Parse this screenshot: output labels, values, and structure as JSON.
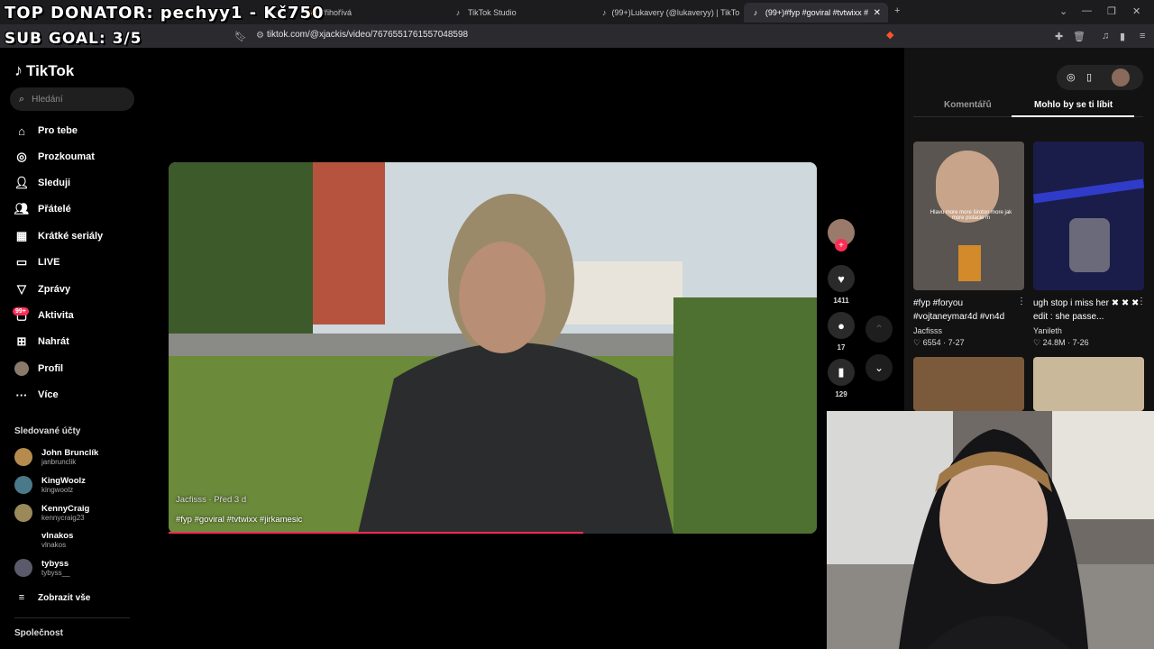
{
  "browser": {
    "tabs": [
      {
        "label": "Přihořívá",
        "icon": "fire-icon"
      },
      {
        "label": "TikTok Studio",
        "icon": "tiktok-icon"
      },
      {
        "label": "(99+)Lukavery (@lukaveryy) | TikTok",
        "icon": "tiktok-icon"
      },
      {
        "label": "(99+)#fyp #goviral #tvtwixx #",
        "icon": "tiktok-icon",
        "active": true
      }
    ],
    "url": "tiktok.com/@xjackis/video/7676551761557048598"
  },
  "overlay": {
    "donator": "TOP DONATOR: pechyy1 - Kč750",
    "goal": "SUB GOAL: 3/5"
  },
  "sidebar": {
    "logo": "TikTok",
    "search_placeholder": "Hledání",
    "nav": [
      {
        "label": "Pro tebe",
        "icon": "home-icon"
      },
      {
        "label": "Prozkoumat",
        "icon": "compass-icon"
      },
      {
        "label": "Sleduji",
        "icon": "following-icon"
      },
      {
        "label": "Přátelé",
        "icon": "friends-icon"
      },
      {
        "label": "Krátké seriály",
        "icon": "series-icon"
      },
      {
        "label": "LIVE",
        "icon": "live-icon"
      },
      {
        "label": "Zprávy",
        "icon": "messages-icon"
      },
      {
        "label": "Aktivita",
        "icon": "activity-icon"
      },
      {
        "label": "Nahrát",
        "icon": "upload-icon"
      },
      {
        "label": "Profil",
        "icon": "profile-avatar"
      },
      {
        "label": "Více",
        "icon": "more-icon"
      }
    ],
    "activity_badge": "99+",
    "followed_title": "Sledované účty",
    "accounts": [
      {
        "name": "John Brunclík",
        "handle": "janbrunclik"
      },
      {
        "name": "KingWoolz",
        "handle": "kingwoolz"
      },
      {
        "name": "KennyCraig",
        "handle": "kennycraig23"
      },
      {
        "name": "vlnakos",
        "handle": "vlnakos"
      },
      {
        "name": "tybyss",
        "handle": "tybyss__"
      }
    ],
    "show_all": "Zobrazit vše",
    "company": "Společnost"
  },
  "video": {
    "author": "Jacfisss · Před 3 d",
    "tags": "#fyp #goviral #tvtwixx #jirkamesic",
    "progress": 0.64
  },
  "actions": {
    "likes": "1411",
    "comments": "17",
    "saves": "129"
  },
  "right_panel": {
    "tabs": [
      "Komentářů",
      "Mohlo by se ti líbit"
    ],
    "cards": [
      {
        "title": "#fyp #foryou #vojtaneymar4d #vn4d",
        "author": "Jacfisss",
        "likes": "6554",
        "date": "7-27",
        "thumb_text": "Hlavu more more široton more jak more pistacie m"
      },
      {
        "title": "ugh stop i miss her ✖ ✖ ✖ edit : she passe...",
        "author": "Yanileth",
        "likes": "24.8M",
        "date": "7-26",
        "thumb_text": ""
      }
    ]
  },
  "colors": {
    "accent": "#fe2c55",
    "bg": "#000000",
    "panel": "#121212"
  }
}
